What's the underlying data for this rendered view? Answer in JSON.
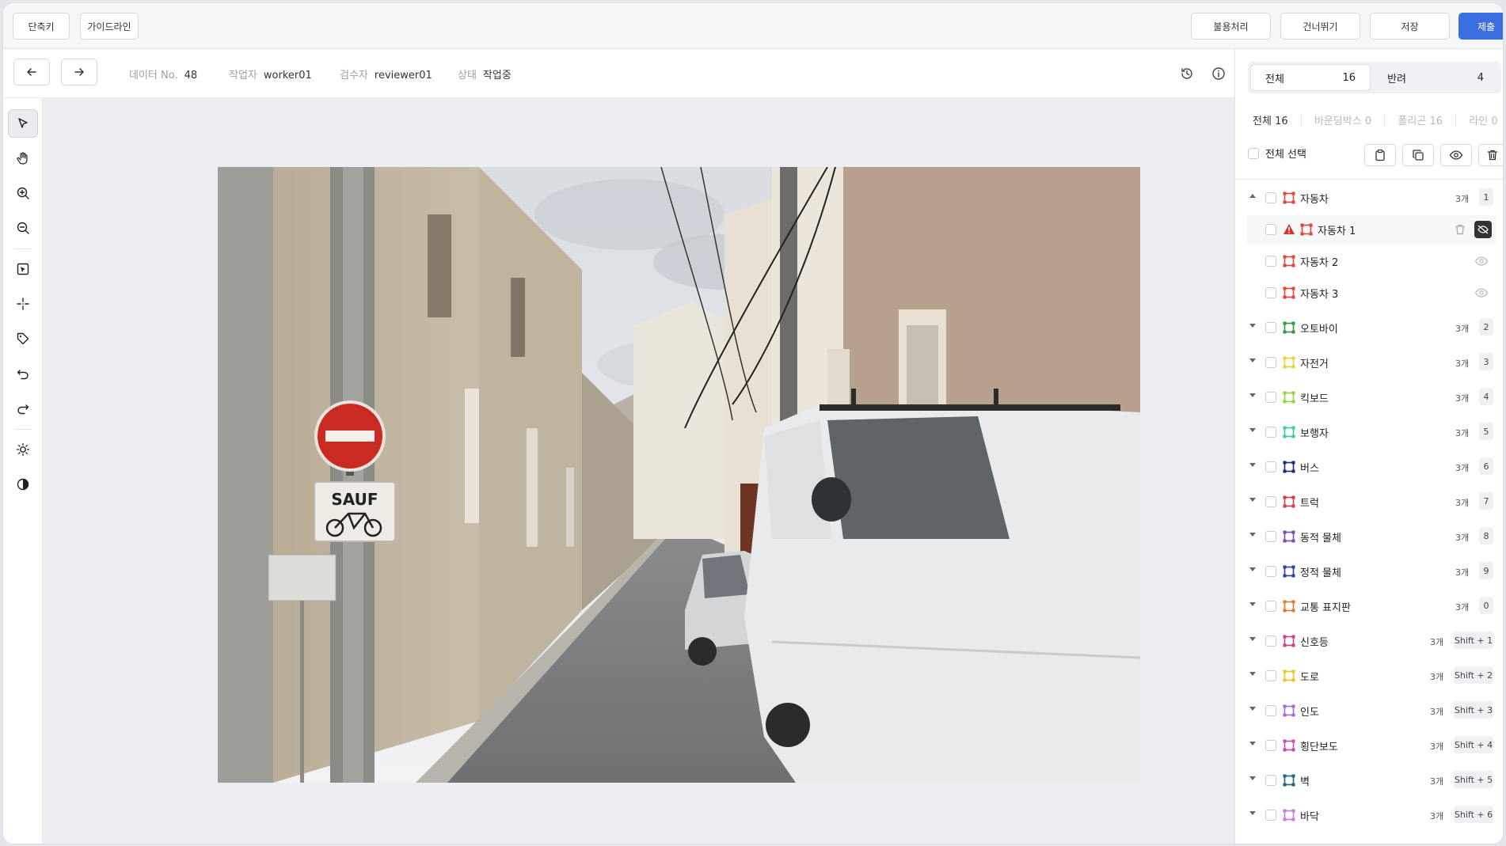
{
  "topbar": {
    "shortcut_label": "단축키",
    "guideline_label": "가이드라인",
    "reject_label": "불용처리",
    "skip_label": "건너뛰기",
    "save_label": "저장",
    "submit_label": "제출"
  },
  "info": {
    "data_no_label": "데이터 No.",
    "data_no": "48",
    "worker_label": "작업자",
    "worker": "worker01",
    "reviewer_label": "검수자",
    "reviewer": "reviewer01",
    "status_label": "상태",
    "status": "작업중"
  },
  "panel": {
    "tabs": [
      {
        "label": "전체",
        "count": "16"
      },
      {
        "label": "반려",
        "count": "4"
      }
    ],
    "counts": [
      {
        "label": "전체",
        "value": "16"
      },
      {
        "label": "바운딩박스",
        "value": "0"
      },
      {
        "label": "폴리곤",
        "value": "16"
      },
      {
        "label": "라인",
        "value": "0"
      }
    ],
    "select_all_label": "전체 선택",
    "classes": [
      {
        "label": "자동차",
        "count": "3개",
        "key": "1",
        "color": "#e0453a",
        "expanded": true
      },
      {
        "label": "오토바이",
        "count": "3개",
        "key": "2",
        "color": "#2e9a44"
      },
      {
        "label": "자전거",
        "count": "3개",
        "key": "3",
        "color": "#e8d13a"
      },
      {
        "label": "킥보드",
        "count": "3개",
        "key": "4",
        "color": "#8fd63c"
      },
      {
        "label": "보행자",
        "count": "3개",
        "key": "5",
        "color": "#3cc9a4"
      },
      {
        "label": "버스",
        "count": "3개",
        "key": "6",
        "color": "#1f2a7a"
      },
      {
        "label": "트럭",
        "count": "3개",
        "key": "7",
        "color": "#d63a4a"
      },
      {
        "label": "동적 물체",
        "count": "3개",
        "key": "8",
        "color": "#7a4ab0"
      },
      {
        "label": "정적 물체",
        "count": "3개",
        "key": "9",
        "color": "#2a3ea8"
      },
      {
        "label": "교통 표지판",
        "count": "3개",
        "key": "0",
        "color": "#e07a2a"
      },
      {
        "label": "신호등",
        "count": "3개",
        "key": "Shift + 1",
        "color": "#d03c8a"
      },
      {
        "label": "도로",
        "count": "3개",
        "key": "Shift + 2",
        "color": "#e8c72a"
      },
      {
        "label": "인도",
        "count": "3개",
        "key": "Shift + 3",
        "color": "#a86ad6"
      },
      {
        "label": "횡단보도",
        "count": "3개",
        "key": "Shift + 4",
        "color": "#c84ab0"
      },
      {
        "label": "벽",
        "count": "3개",
        "key": "Shift + 5",
        "color": "#1a6a7a"
      },
      {
        "label": "바닥",
        "count": "3개",
        "key": "Shift + 6",
        "color": "#c87ae0"
      }
    ],
    "car_children": [
      {
        "label": "자동차 1"
      },
      {
        "label": "자동차 2"
      },
      {
        "label": "자동차 3"
      }
    ]
  },
  "photo": {
    "sign_text": "SAUF"
  },
  "colors": {
    "accent": "#3b6ee0",
    "warning": "#d9342b"
  }
}
